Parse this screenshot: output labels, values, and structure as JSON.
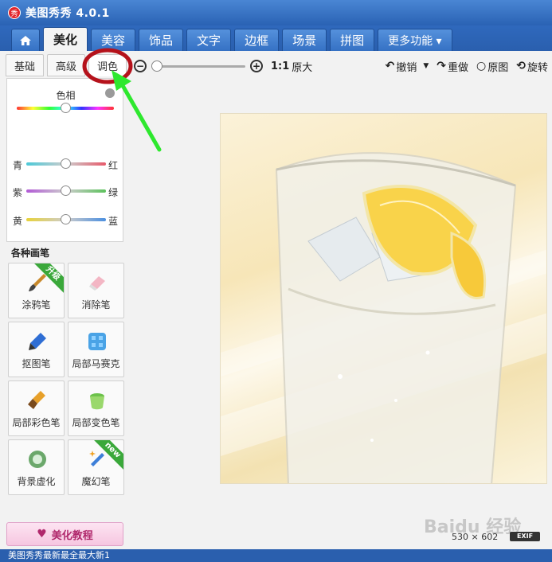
{
  "app": {
    "logo_text": "秀",
    "title": "美图秀秀 4.0.1"
  },
  "main_tabs": [
    {
      "label": "",
      "icon": "home-icon"
    },
    {
      "label": "美化",
      "active": true
    },
    {
      "label": "美容"
    },
    {
      "label": "饰品"
    },
    {
      "label": "文字"
    },
    {
      "label": "边框"
    },
    {
      "label": "场景"
    },
    {
      "label": "拼图"
    },
    {
      "label": "更多功能 ▾"
    }
  ],
  "sub_tabs": [
    {
      "label": "基础"
    },
    {
      "label": "高级"
    },
    {
      "label": "调色",
      "active": true
    }
  ],
  "toolbar": {
    "ratio_label": "1:1",
    "original_size": "原大",
    "undo": "撤销",
    "redo": "重做",
    "original": "原图",
    "rotate": "旋转"
  },
  "adjust": {
    "hue_label": "色相",
    "sliders": [
      {
        "left": "青",
        "right": "红",
        "value": 0.5
      },
      {
        "left": "紫",
        "right": "绿",
        "value": 0.5
      },
      {
        "left": "黄",
        "right": "蓝",
        "value": 0.5
      }
    ],
    "hue_value": 0.5
  },
  "brushes": {
    "heading": "各种画笔",
    "items": [
      {
        "label": "涂鸦笔",
        "badge": "升级"
      },
      {
        "label": "消除笔"
      },
      {
        "label": "抠图笔"
      },
      {
        "label": "局部马赛克"
      },
      {
        "label": "局部彩色笔"
      },
      {
        "label": "局部变色笔"
      },
      {
        "label": "背景虚化"
      },
      {
        "label": "魔幻笔",
        "badge": "new"
      }
    ]
  },
  "tutorial_label": "美化教程",
  "image_size": "530 × 602",
  "exif_label": "EXIF",
  "watermark": "Baidu 经验",
  "status_text": "美图秀秀最新最全最大新1"
}
